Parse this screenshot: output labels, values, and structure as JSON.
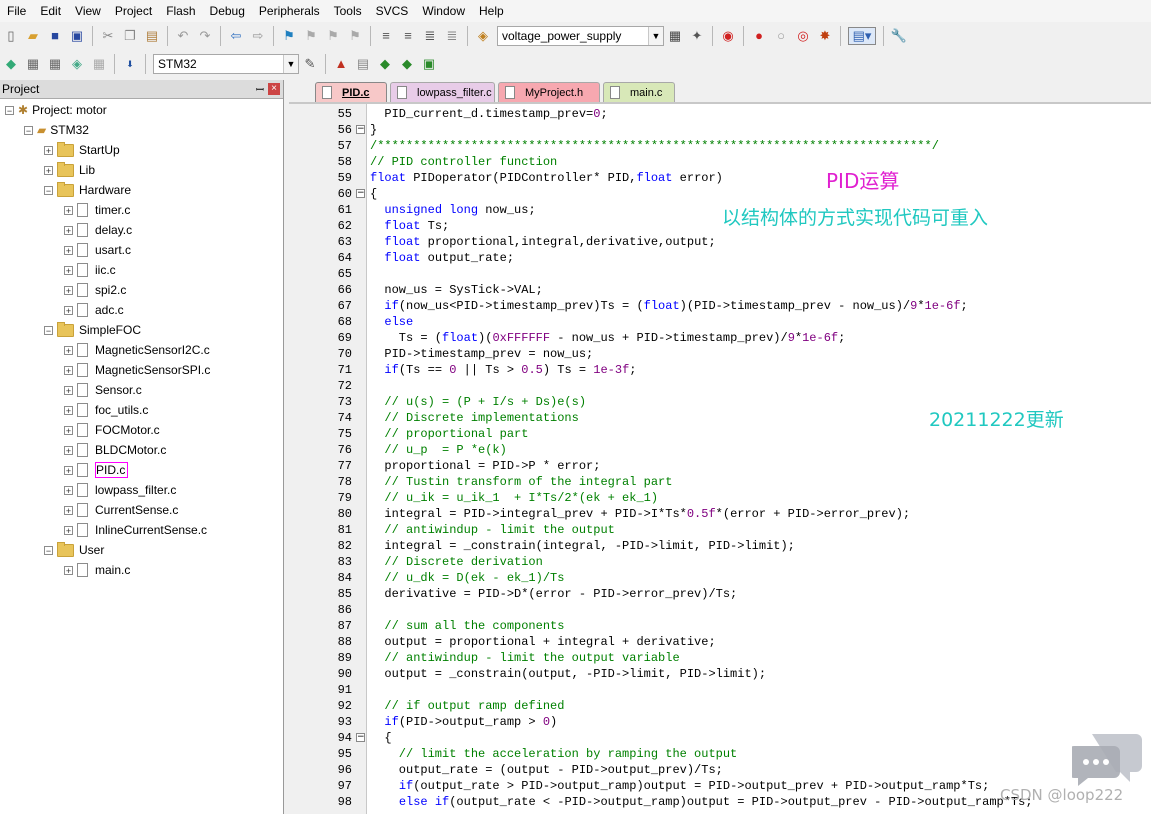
{
  "menu": [
    "File",
    "Edit",
    "View",
    "Project",
    "Flash",
    "Debug",
    "Peripherals",
    "Tools",
    "SVCS",
    "Window",
    "Help"
  ],
  "toolbar": {
    "target_combo": "voltage_power_supply",
    "target_select": "STM32"
  },
  "project_panel": {
    "title": "Project",
    "pin": "ꟷ",
    "close": "×",
    "root": "Project: motor",
    "target": "STM32",
    "tree": [
      {
        "label": "StartUp",
        "type": "folder",
        "level": 2,
        "exp": "+"
      },
      {
        "label": "Lib",
        "type": "folder",
        "level": 2,
        "exp": "+"
      },
      {
        "label": "Hardware",
        "type": "folder",
        "level": 2,
        "exp": "−"
      },
      {
        "label": "timer.c",
        "type": "file",
        "level": 3,
        "exp": "+"
      },
      {
        "label": "delay.c",
        "type": "file",
        "level": 3,
        "exp": "+"
      },
      {
        "label": "usart.c",
        "type": "file",
        "level": 3,
        "exp": "+"
      },
      {
        "label": "iic.c",
        "type": "file",
        "level": 3,
        "exp": "+"
      },
      {
        "label": "spi2.c",
        "type": "file",
        "level": 3,
        "exp": "+"
      },
      {
        "label": "adc.c",
        "type": "file",
        "level": 3,
        "exp": "+"
      },
      {
        "label": "SimpleFOC",
        "type": "folder",
        "level": 2,
        "exp": "−"
      },
      {
        "label": "MagneticSensorI2C.c",
        "type": "file",
        "level": 3,
        "exp": "+"
      },
      {
        "label": "MagneticSensorSPI.c",
        "type": "file",
        "level": 3,
        "exp": "+"
      },
      {
        "label": "Sensor.c",
        "type": "file",
        "level": 3,
        "exp": "+"
      },
      {
        "label": "foc_utils.c",
        "type": "file",
        "level": 3,
        "exp": "+"
      },
      {
        "label": "FOCMotor.c",
        "type": "file",
        "level": 3,
        "exp": "+"
      },
      {
        "label": "BLDCMotor.c",
        "type": "file",
        "level": 3,
        "exp": "+"
      },
      {
        "label": "PID.c",
        "type": "file",
        "level": 3,
        "exp": "+",
        "selected": true
      },
      {
        "label": "lowpass_filter.c",
        "type": "file",
        "level": 3,
        "exp": "+"
      },
      {
        "label": "CurrentSense.c",
        "type": "file",
        "level": 3,
        "exp": "+"
      },
      {
        "label": "InlineCurrentSense.c",
        "type": "file",
        "level": 3,
        "exp": "+"
      },
      {
        "label": "User",
        "type": "folder",
        "level": 2,
        "exp": "−"
      },
      {
        "label": "main.c",
        "type": "file",
        "level": 3,
        "exp": "+"
      }
    ]
  },
  "tabs": [
    {
      "label": "PID.c",
      "bg": "#f7c8c8",
      "active": true
    },
    {
      "label": "lowpass_filter.c",
      "bg": "#e8cce8"
    },
    {
      "label": "MyProject.h",
      "bg": "#f7a8b0"
    },
    {
      "label": "main.c",
      "bg": "#d8e8b8"
    }
  ],
  "code_lines": [
    {
      "n": "55",
      "t": "  PID_current_d.timestamp_prev=0;"
    },
    {
      "n": "56",
      "t": "}",
      "f": "−"
    },
    {
      "n": "57",
      "t": "/*****************************************************************************/",
      "c": "cm"
    },
    {
      "n": "58",
      "t": "// PID controller function",
      "c": "cm"
    },
    {
      "n": "59",
      "t": "float PIDoperator(PIDController* PID,float error)"
    },
    {
      "n": "60",
      "t": "{",
      "f": "−"
    },
    {
      "n": "61",
      "t": "  unsigned long now_us;"
    },
    {
      "n": "62",
      "t": "  float Ts;"
    },
    {
      "n": "63",
      "t": "  float proportional,integral,derivative,output;"
    },
    {
      "n": "64",
      "t": "  float output_rate;"
    },
    {
      "n": "65",
      "t": ""
    },
    {
      "n": "66",
      "t": "  now_us = SysTick->VAL;"
    },
    {
      "n": "67",
      "t": "  if(now_us<PID->timestamp_prev)Ts = (float)(PID->timestamp_prev - now_us)/9*1e-6f;"
    },
    {
      "n": "68",
      "t": "  else"
    },
    {
      "n": "69",
      "t": "    Ts = (float)(0xFFFFFF - now_us + PID->timestamp_prev)/9*1e-6f;"
    },
    {
      "n": "70",
      "t": "  PID->timestamp_prev = now_us;"
    },
    {
      "n": "71",
      "t": "  if(Ts == 0 || Ts > 0.5) Ts = 1e-3f;"
    },
    {
      "n": "72",
      "t": ""
    },
    {
      "n": "73",
      "t": "  // u(s) = (P + I/s + Ds)e(s)",
      "c": "cm"
    },
    {
      "n": "74",
      "t": "  // Discrete implementations",
      "c": "cm"
    },
    {
      "n": "75",
      "t": "  // proportional part",
      "c": "cm"
    },
    {
      "n": "76",
      "t": "  // u_p  = P *e(k)",
      "c": "cm"
    },
    {
      "n": "77",
      "t": "  proportional = PID->P * error;"
    },
    {
      "n": "78",
      "t": "  // Tustin transform of the integral part",
      "c": "cm"
    },
    {
      "n": "79",
      "t": "  // u_ik = u_ik_1  + I*Ts/2*(ek + ek_1)",
      "c": "cm"
    },
    {
      "n": "80",
      "t": "  integral = PID->integral_prev + PID->I*Ts*0.5f*(error + PID->error_prev);"
    },
    {
      "n": "81",
      "t": "  // antiwindup - limit the output",
      "c": "cm"
    },
    {
      "n": "82",
      "t": "  integral = _constrain(integral, -PID->limit, PID->limit);"
    },
    {
      "n": "83",
      "t": "  // Discrete derivation",
      "c": "cm"
    },
    {
      "n": "84",
      "t": "  // u_dk = D(ek - ek_1)/Ts",
      "c": "cm"
    },
    {
      "n": "85",
      "t": "  derivative = PID->D*(error - PID->error_prev)/Ts;"
    },
    {
      "n": "86",
      "t": ""
    },
    {
      "n": "87",
      "t": "  // sum all the components",
      "c": "cm"
    },
    {
      "n": "88",
      "t": "  output = proportional + integral + derivative;"
    },
    {
      "n": "89",
      "t": "  // antiwindup - limit the output variable",
      "c": "cm"
    },
    {
      "n": "90",
      "t": "  output = _constrain(output, -PID->limit, PID->limit);"
    },
    {
      "n": "91",
      "t": ""
    },
    {
      "n": "92",
      "t": "  // if output ramp defined",
      "c": "cm"
    },
    {
      "n": "93",
      "t": "  if(PID->output_ramp > 0)"
    },
    {
      "n": "94",
      "t": "  {",
      "f": "−"
    },
    {
      "n": "95",
      "t": "    // limit the acceleration by ramping the output",
      "c": "cm"
    },
    {
      "n": "96",
      "t": "    output_rate = (output - PID->output_prev)/Ts;"
    },
    {
      "n": "97",
      "t": "    if(output_rate > PID->output_ramp)output = PID->output_prev + PID->output_ramp*Ts;"
    },
    {
      "n": "98",
      "t": "    else if(output_rate < -PID->output_ramp)output = PID->output_prev - PID->output_ramp*Ts;"
    }
  ],
  "annotations": {
    "pid_title": "PID运算",
    "pid_title_color": "#e020d0",
    "reentrant_note": "以结构体的方式实现代码可重入",
    "reentrant_color": "#20c8c0",
    "date_note": "20211222更新",
    "date_color": "#20c8c0",
    "watermark": "CSDN @loop222"
  },
  "keywords": [
    "unsigned",
    "long",
    "float",
    "if",
    "else"
  ]
}
